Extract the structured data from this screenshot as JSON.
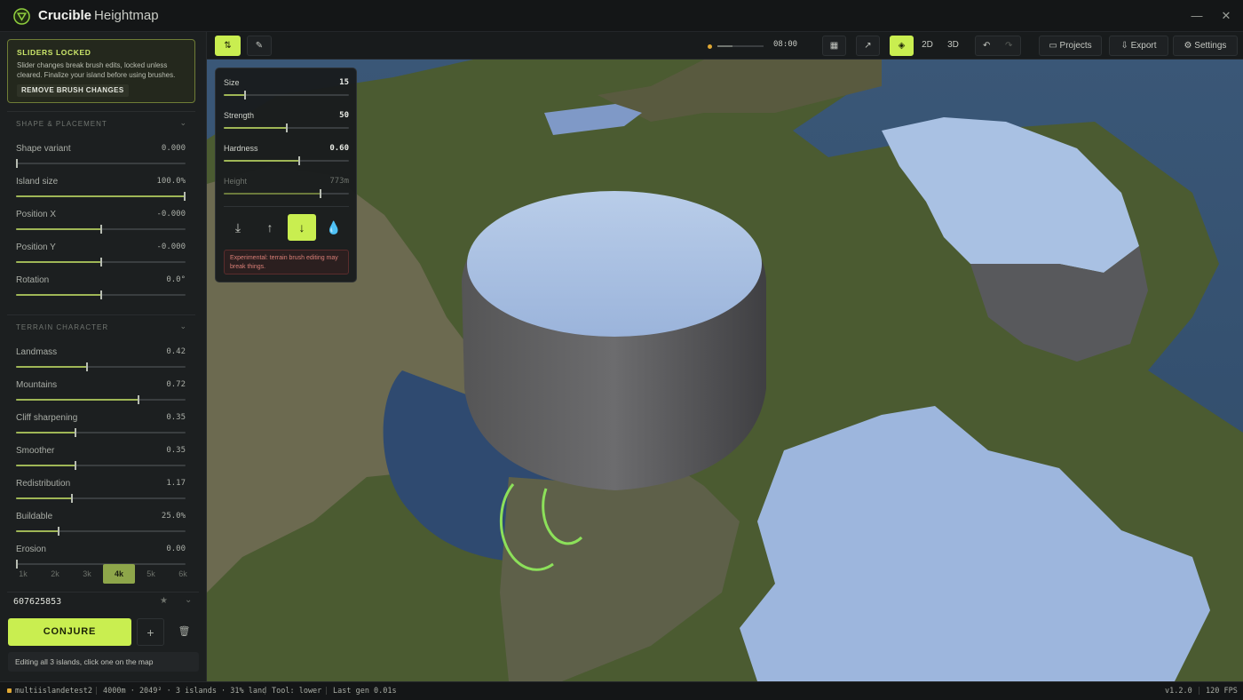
{
  "app": {
    "name": "Crucible",
    "subtitle": "Heightmap"
  },
  "window_controls": {
    "minimize": "—",
    "close": "✕"
  },
  "locked_notice": {
    "title": "SLIDERS LOCKED",
    "text": "Slider changes break brush edits, locked unless cleared. Finalize your island before using brushes.",
    "button": "REMOVE BRUSH CHANGES"
  },
  "sections": {
    "shape": {
      "title": "SHAPE & PLACEMENT",
      "params": [
        {
          "name": "Shape variant",
          "value": "0.000",
          "level": 0.0
        },
        {
          "name": "Island size",
          "value": "100.0%",
          "level": 1.0
        },
        {
          "name": "Position X",
          "value": "-0.000",
          "level": 0.5
        },
        {
          "name": "Position Y",
          "value": "-0.000",
          "level": 0.5
        },
        {
          "name": "Rotation",
          "value": "0.0°",
          "level": 0.5
        }
      ]
    },
    "terrain": {
      "title": "TERRAIN CHARACTER",
      "params": [
        {
          "name": "Landmass",
          "value": "0.42",
          "level": 0.42
        },
        {
          "name": "Mountains",
          "value": "0.72",
          "level": 0.72
        },
        {
          "name": "Cliff sharpening",
          "value": "0.35",
          "level": 0.35
        },
        {
          "name": "Smoother",
          "value": "0.35",
          "level": 0.35
        },
        {
          "name": "Redistribution",
          "value": "1.17",
          "level": 0.33
        },
        {
          "name": "Buildable",
          "value": "25.0%",
          "level": 0.25
        },
        {
          "name": "Erosion",
          "value": "0.00",
          "level": 0.0
        }
      ]
    }
  },
  "resolutions": {
    "options": [
      "1k",
      "2k",
      "3k",
      "4k",
      "5k",
      "6k"
    ],
    "selected": "4k"
  },
  "seed": "607625853",
  "actions": {
    "conjure": "CONJURE",
    "add": "+"
  },
  "hint": "Editing all 3 islands, click one on the map",
  "toolbar": {
    "time": "08:00",
    "time_level": 0.33,
    "view_2d": "2D",
    "view_3d": "3D",
    "projects": "Projects",
    "export": "Export",
    "settings": "Settings"
  },
  "brush": {
    "params": [
      {
        "name": "Size",
        "value": "15",
        "level": 0.17
      },
      {
        "name": "Strength",
        "value": "50",
        "level": 0.5
      },
      {
        "name": "Hardness",
        "value": "0.60",
        "level": 0.6
      },
      {
        "name": "Height",
        "value": "773m",
        "level": 0.77
      }
    ],
    "modes": [
      "flatten",
      "raise",
      "lower",
      "smooth"
    ],
    "active_mode": "lower",
    "warning": "Experimental: terrain brush editing may break things."
  },
  "status": {
    "project": "multiislandetest2",
    "details": "4000m · 2049² · 3 islands · 31% land",
    "tool": "Tool: lower",
    "last_gen": "Last gen 0.01s",
    "version": "v1.2.0",
    "fps": "120 FPS"
  },
  "colors": {
    "accent": "#c9ee50",
    "water": "#3f5b7c",
    "grass": "#4a5a30",
    "sand": "#6b6b4e",
    "snow": "#a8bfe0",
    "rock": "#5a5a5e"
  }
}
